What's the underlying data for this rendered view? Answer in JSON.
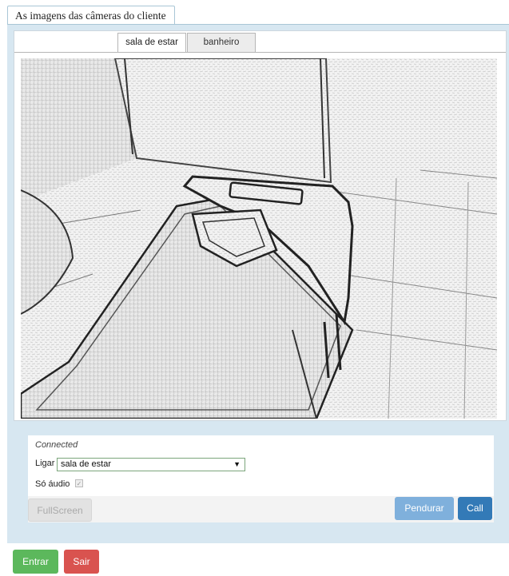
{
  "window_title": "As imagens das câmeras do cliente",
  "tabs": [
    {
      "label": "sala de estar",
      "active": true
    },
    {
      "label": "banheiro",
      "active": false
    }
  ],
  "camera": {
    "icon": "camera-feed-image"
  },
  "controls": {
    "status": "Connected",
    "ligar_label": "Ligar",
    "ligar_selected": "sala de estar",
    "audio_label": "Só áudio",
    "audio_checked": true,
    "fullscreen_label": "FullScreen",
    "pendurar_label": "Pendurar",
    "call_label": "Call"
  },
  "footer": {
    "entrar_label": "Entrar",
    "sair_label": "Sair"
  },
  "colors": {
    "panel_bg": "#d7e7f1",
    "primary": "#337ab7",
    "success": "#5cb85c",
    "danger": "#d9534f"
  }
}
